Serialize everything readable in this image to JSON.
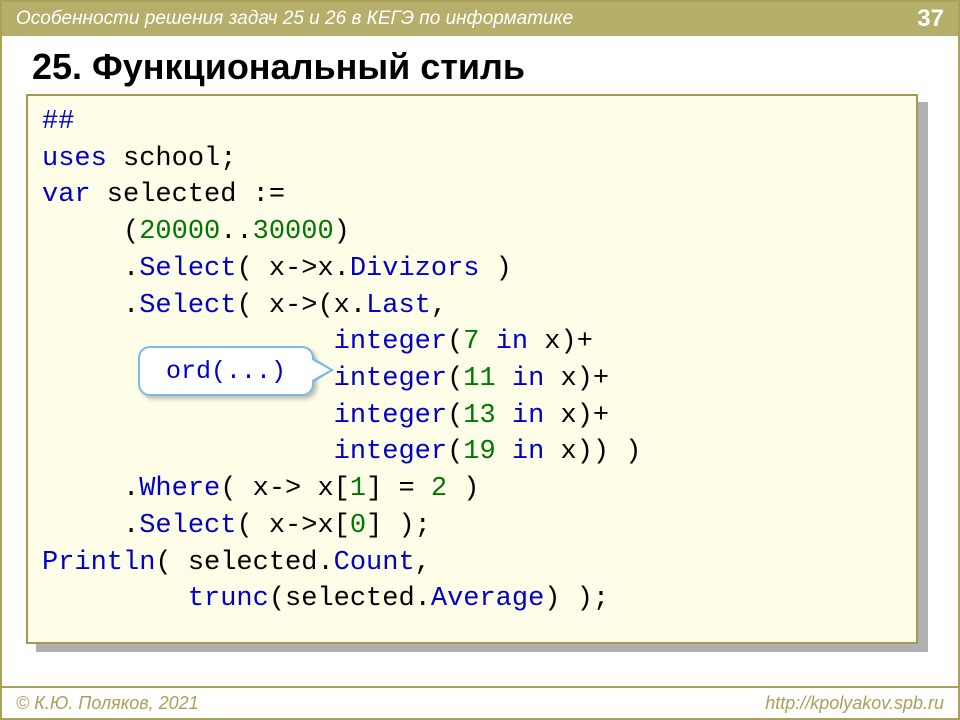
{
  "header": {
    "subject": "Особенности решения задач 25 и 26 в КЕГЭ по информатике",
    "page": "37"
  },
  "title": "25. Функциональный стиль",
  "code": {
    "l1_a": "##",
    "l2_a": "uses",
    "l2_b": " school;",
    "l3_a": "var",
    "l3_b": " selected :=",
    "l4_a": "     (",
    "l4_b": "20000",
    "l4_c": "..",
    "l4_d": "30000",
    "l4_e": ")",
    "l5_a": "     .",
    "l5_b": "Select",
    "l5_c": "( x->x.",
    "l5_d": "Divizors",
    "l5_e": " )",
    "l6_a": "     .",
    "l6_b": "Select",
    "l6_c": "( x->(x.",
    "l6_d": "Last",
    "l6_e": ",",
    "l7_a": "                  ",
    "l7_b": "integer",
    "l7_c": "(",
    "l7_d": "7",
    "l7_e": " ",
    "l7_f": "in",
    "l7_g": " x)+",
    "l8_a": "                  ",
    "l8_b": "integer",
    "l8_c": "(",
    "l8_d": "11",
    "l8_e": " ",
    "l8_f": "in",
    "l8_g": " x)+",
    "l9_a": "                  ",
    "l9_b": "integer",
    "l9_c": "(",
    "l9_d": "13",
    "l9_e": " ",
    "l9_f": "in",
    "l9_g": " x)+",
    "l10_a": "                  ",
    "l10_b": "integer",
    "l10_c": "(",
    "l10_d": "19",
    "l10_e": " ",
    "l10_f": "in",
    "l10_g": " x)) )",
    "l11_a": "     .",
    "l11_b": "Where",
    "l11_c": "( x-> x[",
    "l11_d": "1",
    "l11_e": "] = ",
    "l11_f": "2",
    "l11_g": " )",
    "l12_a": "     .",
    "l12_b": "Select",
    "l12_c": "( x->x[",
    "l12_d": "0",
    "l12_e": "] );",
    "l13_a": "Println",
    "l13_b": "( selected.",
    "l13_c": "Count",
    "l13_d": ",",
    "l14_a": "         ",
    "l14_b": "trunc",
    "l14_c": "(selected.",
    "l14_d": "Average",
    "l14_e": ") );"
  },
  "bubble": "ord(...)",
  "footer": {
    "left": "© К.Ю. Поляков, 2021",
    "right": "http://kpolyakov.spb.ru"
  }
}
